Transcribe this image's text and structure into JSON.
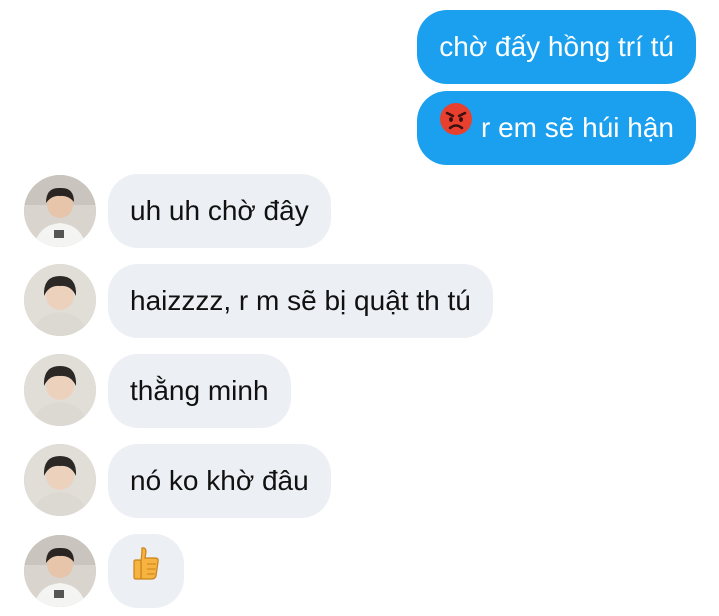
{
  "messages": [
    {
      "id": "m1",
      "direction": "out",
      "text": "chờ đấy hồng trí tú"
    },
    {
      "id": "m2",
      "direction": "out",
      "icon": "angry-face-icon",
      "text": "r em sẽ húi hận"
    },
    {
      "id": "m3",
      "direction": "in",
      "text": "uh uh chờ đây"
    },
    {
      "id": "m4",
      "direction": "in",
      "text": "haizzzz, r m sẽ bị quật th tú"
    },
    {
      "id": "m5",
      "direction": "in",
      "text": "thằng minh"
    },
    {
      "id": "m6",
      "direction": "in",
      "text": "nó ko khờ đâu"
    },
    {
      "id": "m7",
      "direction": "in",
      "icon": "thumbs-up-icon",
      "text": ""
    }
  ],
  "colors": {
    "outgoing_bubble": "#1aa0ee",
    "incoming_bubble": "#eceff3",
    "outgoing_text": "#ffffff",
    "incoming_text": "#111111"
  }
}
